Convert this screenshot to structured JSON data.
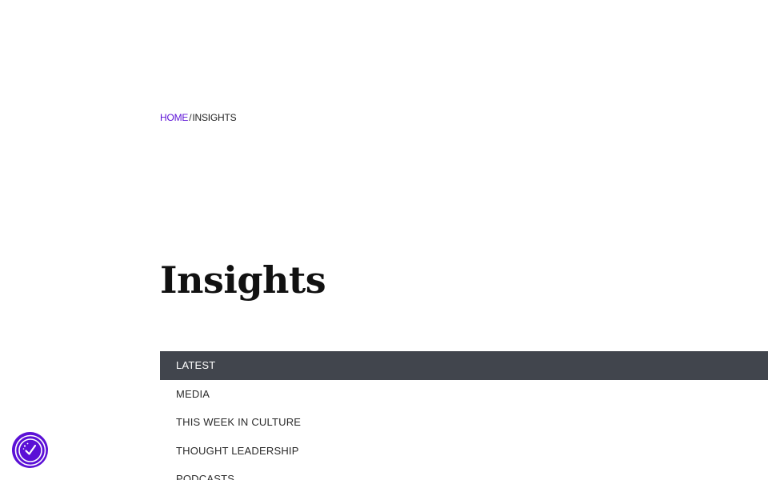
{
  "breadcrumb": {
    "home": "HOME",
    "separator": "/",
    "current": "INSIGHTS"
  },
  "page_title": "Insights",
  "categories": [
    {
      "label": "LATEST",
      "active": true
    },
    {
      "label": "MEDIA",
      "active": false
    },
    {
      "label": "THIS WEEK IN CULTURE",
      "active": false
    },
    {
      "label": "THOUGHT LEADERSHIP",
      "active": false
    },
    {
      "label": "PODCASTS",
      "active": false
    }
  ],
  "colors": {
    "accent": "#5b10d6",
    "active_tab_bg": "#41454d",
    "title": "#111111"
  },
  "badge": {
    "icon": "cookie-consent-icon"
  }
}
